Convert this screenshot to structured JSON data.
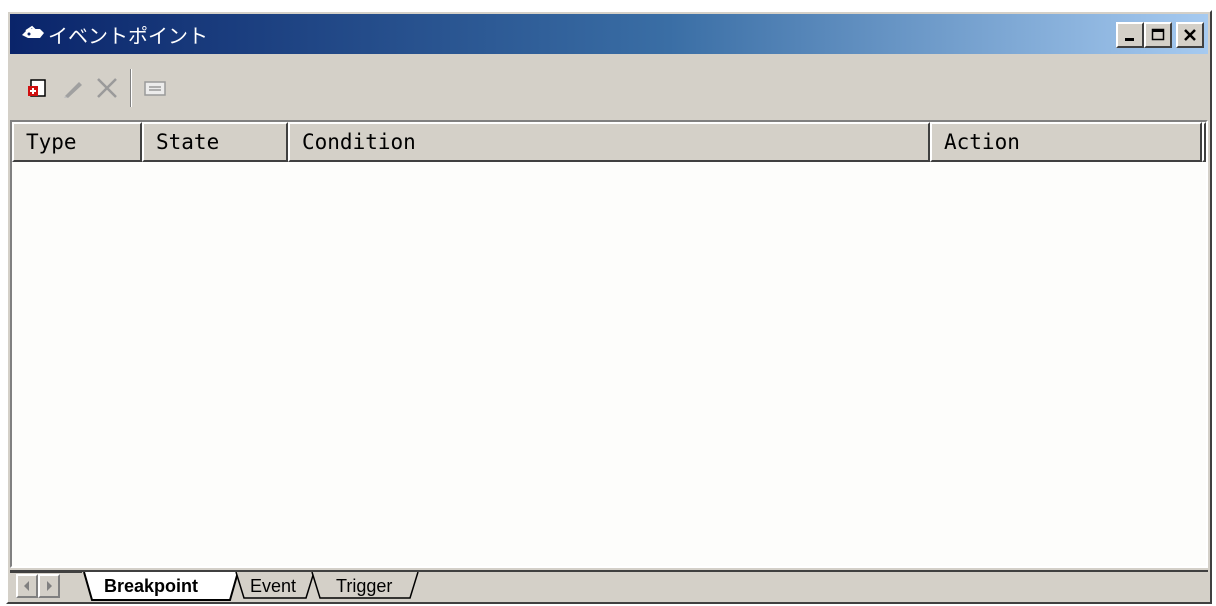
{
  "window": {
    "title": "イベントポイント",
    "icon": "eventpoint-app-icon",
    "caption_buttons": [
      "minimize-icon",
      "maximize-icon",
      "close-icon"
    ]
  },
  "toolbar": {
    "buttons": [
      {
        "name": "add-icon",
        "enabled": true
      },
      {
        "name": "edit-icon",
        "enabled": false
      },
      {
        "name": "delete-icon",
        "enabled": false
      },
      {
        "name": "properties-icon",
        "enabled": false
      }
    ]
  },
  "table": {
    "columns": [
      "Type",
      "State",
      "Condition",
      "Action"
    ],
    "rows": []
  },
  "tabs": {
    "items": [
      {
        "label": "Breakpoint",
        "active": true
      },
      {
        "label": "Event",
        "active": false
      },
      {
        "label": "Trigger",
        "active": false
      }
    ]
  },
  "colors": {
    "title_gradient_start": "#0a246a",
    "title_gradient_end": "#a6caf0",
    "face": "#d4d0c8",
    "list_background": "#fdfdfb"
  }
}
